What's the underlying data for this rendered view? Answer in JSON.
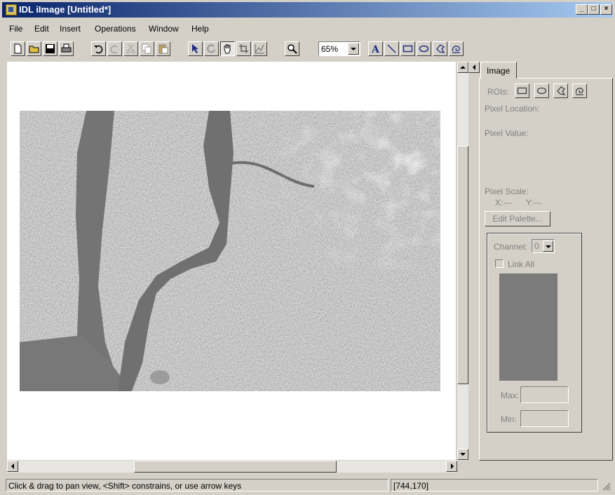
{
  "window": {
    "title": "IDL iImage [Untitled*]",
    "minimize_glyph": "_",
    "maximize_glyph": "□",
    "close_glyph": "×"
  },
  "menu": {
    "items": [
      "File",
      "Edit",
      "Insert",
      "Operations",
      "Window",
      "Help"
    ]
  },
  "toolbar": {
    "zoom_value": "65%",
    "icons": [
      "new-file-icon",
      "open-folder-icon",
      "save-disk-icon",
      "print-icon",
      "undo-icon",
      "redo-icon",
      "cut-icon",
      "copy-icon",
      "paste-icon",
      "select-arrow-icon",
      "rotate-icon",
      "pan-hand-icon",
      "crop-icon",
      "line-profile-icon",
      "zoom-magnifier-icon",
      "text-annotation-icon",
      "line-icon",
      "rectangle-icon",
      "ellipse-icon",
      "polygon-icon",
      "freehand-icon"
    ],
    "pressed": "pan-hand-icon"
  },
  "panel": {
    "tab_label": "Image",
    "rois_label": "ROIs:",
    "pixel_location_label": "Pixel Location:",
    "pixel_value_label": "Pixel Value:",
    "pixel_scale_label": "Pixel Scale:",
    "x_readout": "X:---",
    "y_readout": "Y:---",
    "edit_palette_label": "Edit Palette...",
    "channel_label": "Channel:",
    "channel_value": "0",
    "link_all_label": "Link All",
    "max_label": "Max:",
    "min_label": "Min:"
  },
  "status": {
    "message": "Click & drag to pan view, <Shift> constrains, or use arrow keys",
    "coords": "[744,170]"
  },
  "colors": {
    "title_gradient_start": "#0a246a",
    "title_gradient_end": "#a6caf0",
    "chrome": "#d4d0c8",
    "palette_swatch": "#7b7b7b"
  }
}
